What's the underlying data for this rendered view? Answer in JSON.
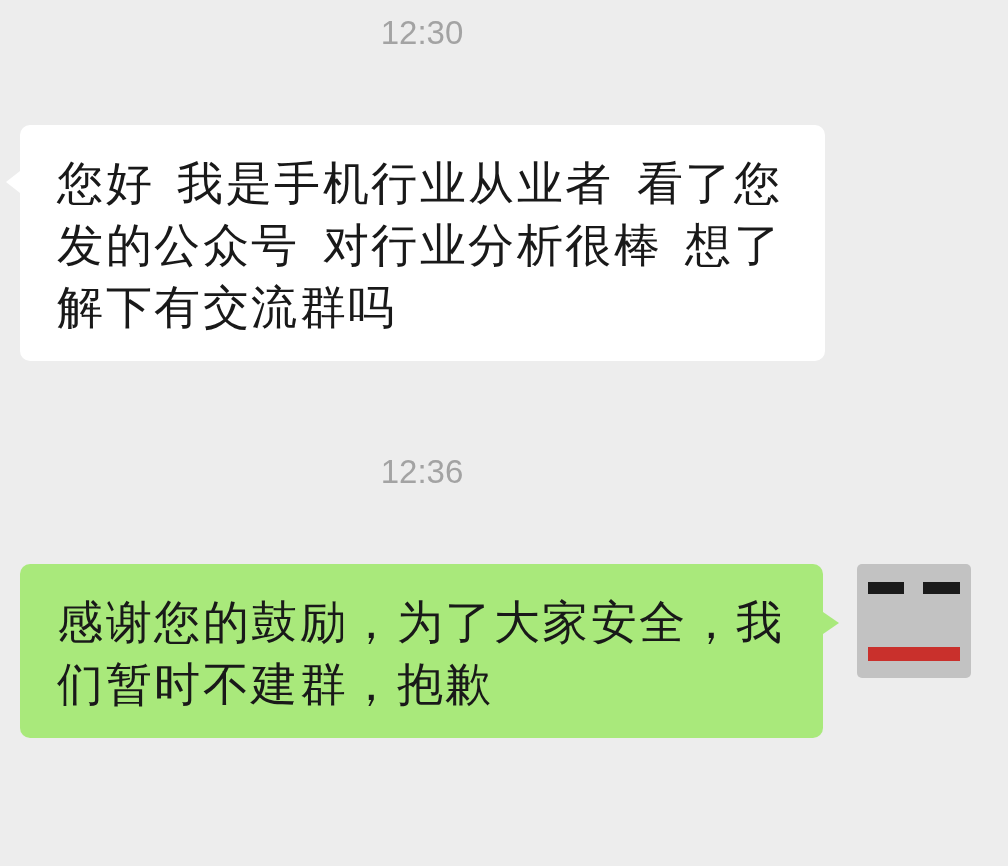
{
  "messages": [
    {
      "kind": "time",
      "text": "12:30"
    },
    {
      "kind": "received",
      "text": "您好 我是手机行业从业者 看了您发的公众号 对行业分析很棒 想了解下有交流群吗"
    },
    {
      "kind": "time",
      "text": "12:36"
    },
    {
      "kind": "sent",
      "text": "感谢您的鼓励，为了大家安全，我们暂时不建群，抱歉"
    }
  ]
}
